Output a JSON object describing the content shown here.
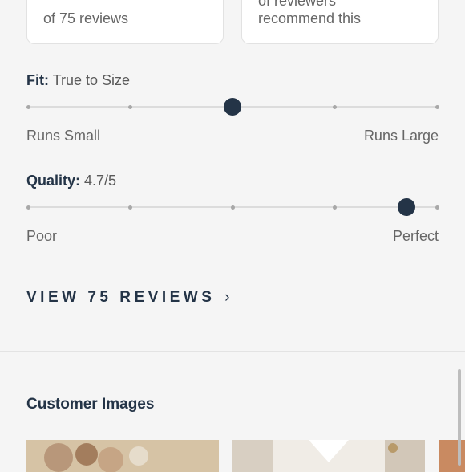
{
  "summary": {
    "rating_card": {
      "count_text": "of 75 reviews",
      "stars": "★★★★★"
    },
    "recommend_card": {
      "line1": "of reviewers",
      "line2": "recommend this"
    }
  },
  "fit": {
    "label": "Fit:",
    "value": "True to Size",
    "min_label": "Runs Small",
    "max_label": "Runs Large",
    "level": 0.5
  },
  "quality": {
    "label": "Quality:",
    "value": "4.7/5",
    "min_label": "Poor",
    "max_label": "Perfect",
    "level": 0.925
  },
  "view_reviews": {
    "label": "VIEW 75 REVIEWS",
    "chevron": "›"
  },
  "customer_images": {
    "title": "Customer Images"
  },
  "colors": {
    "accent": "#243447",
    "track": "#dcdcdc",
    "tick": "#a8a8a8"
  }
}
